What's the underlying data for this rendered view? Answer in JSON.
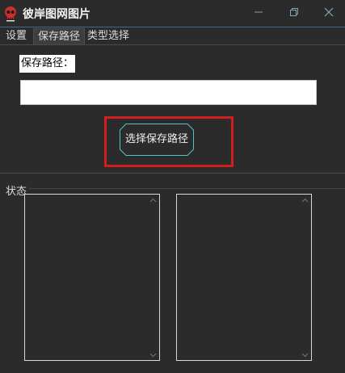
{
  "window": {
    "title": "彼岸图网图片",
    "icon": "skull-icon",
    "controls": [
      "minimize-icon",
      "restore-icon",
      "close-icon"
    ]
  },
  "tabs": [
    {
      "label": "设置",
      "active": false
    },
    {
      "label": "保存路径",
      "active": true
    },
    {
      "label": "类型选择",
      "active": false
    }
  ],
  "save_path": {
    "label": "保存路径：",
    "value": "",
    "placeholder": "",
    "button_label": "选择保存路径"
  },
  "status": {
    "label": "状态",
    "panels": [
      {
        "text": ""
      },
      {
        "text": ""
      }
    ]
  },
  "colors": {
    "background": "#2b2b2b",
    "accent": "#3a6f7e",
    "highlight": "#d11f1f",
    "button_border": "#4fc3c9"
  }
}
